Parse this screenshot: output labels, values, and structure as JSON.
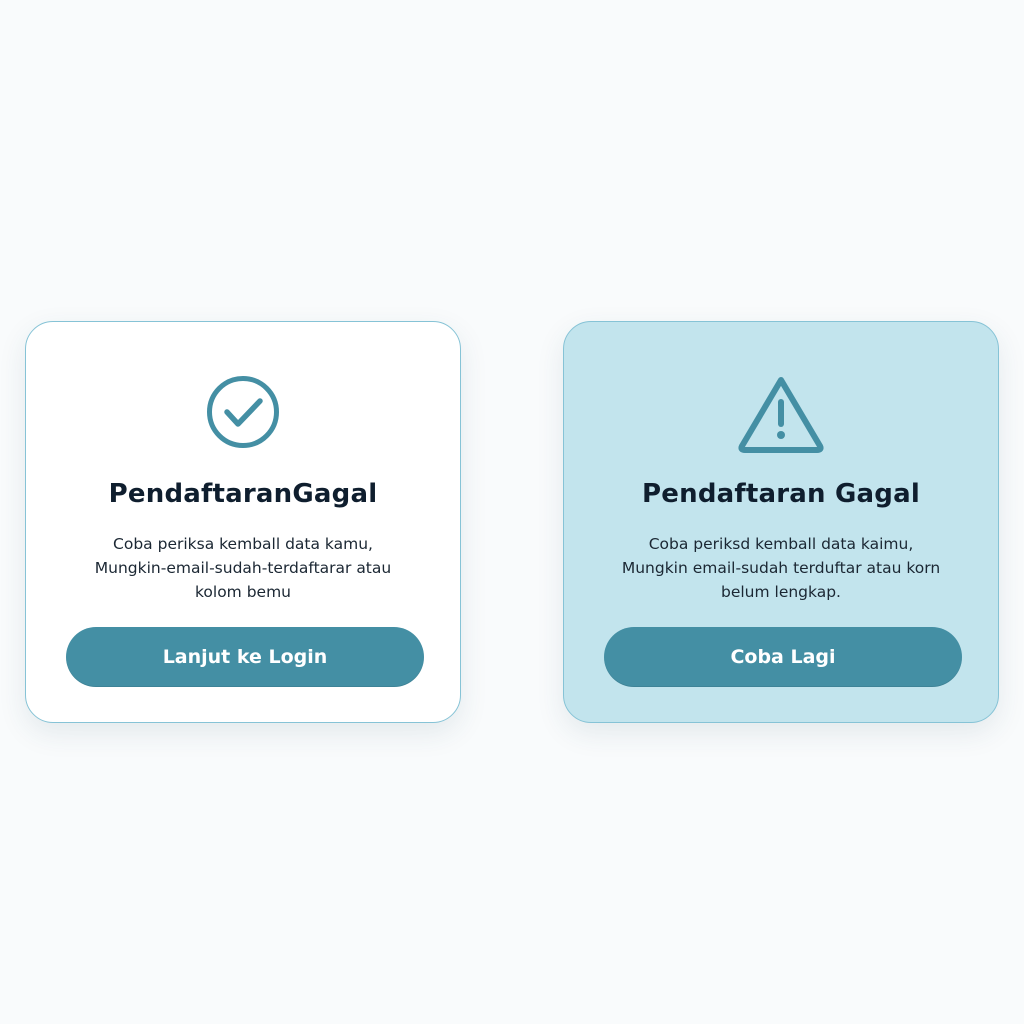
{
  "colors": {
    "background": "#f9fbfc",
    "accent": "#448fa4",
    "card_border": "#86c3d6",
    "success_card_bg": "#ffffff",
    "error_card_bg": "#c2e4ed",
    "title_text": "#0f1e2e"
  },
  "cards": [
    {
      "icon": "check-circle-icon",
      "title": "PendaftaranGagal",
      "description": [
        "Coba periksa kemball data kamu,",
        "Mungkin-email-sudah-terdaftarar atau",
        "kolom bemu"
      ],
      "button_label": "Lanjut ke Login"
    },
    {
      "icon": "warning-triangle-icon",
      "title": "Pendaftaran Gagal",
      "description": [
        "Coba periksd kemball data kaimu,",
        "Mungkin email-sudah terduftar atau korn",
        "belum lengkap."
      ],
      "button_label": "Coba Lagi"
    }
  ]
}
